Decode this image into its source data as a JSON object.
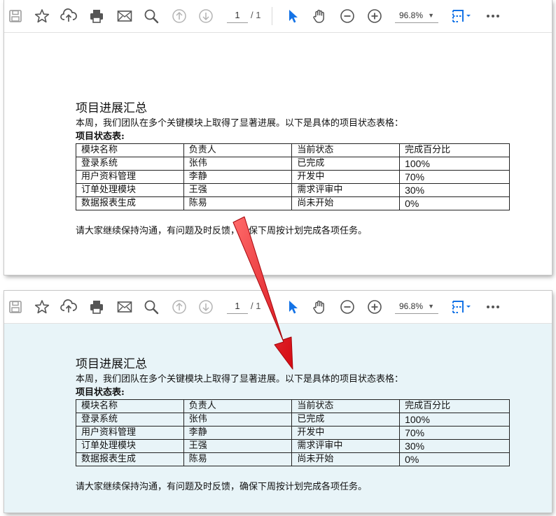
{
  "toolbar": {
    "page_current": "1",
    "page_total": "/ 1",
    "zoom": "96.8%",
    "icons": [
      "save-icon",
      "bookmark-star-icon",
      "upload-icon",
      "print-icon",
      "email-icon",
      "search-zoom-icon",
      "page-up-icon",
      "page-down-icon",
      "select-cursor-icon",
      "hand-tool-icon",
      "zoom-out-icon",
      "zoom-in-icon",
      "page-view-icon",
      "more-icon"
    ]
  },
  "document": {
    "title": "项目进展汇总",
    "intro": "本周，我们团队在多个关键模块上取得了显著进展。以下是具体的项目状态表格：",
    "table_label": "项目状态表:",
    "table_headers": [
      "模块名称",
      "负责人",
      "当前状态",
      "完成百分比"
    ],
    "table_rows": [
      [
        "登录系统",
        "张伟",
        "已完成",
        "100%"
      ],
      [
        "用户资料管理",
        "李静",
        "开发中",
        "70%"
      ],
      [
        "订单处理模块",
        "王强",
        "需求评审中",
        "30%"
      ],
      [
        "数据报表生成",
        "陈易",
        "尚未开始",
        "0%"
      ]
    ],
    "closing": "请大家继续保持沟通，有问题及时反馈，确保下周按计划完成各项任务。"
  },
  "colors": {
    "accent_blue": "#1473e6",
    "bottom_page_bg": "#e8f4f8",
    "arrow_red": "#e8121b"
  }
}
